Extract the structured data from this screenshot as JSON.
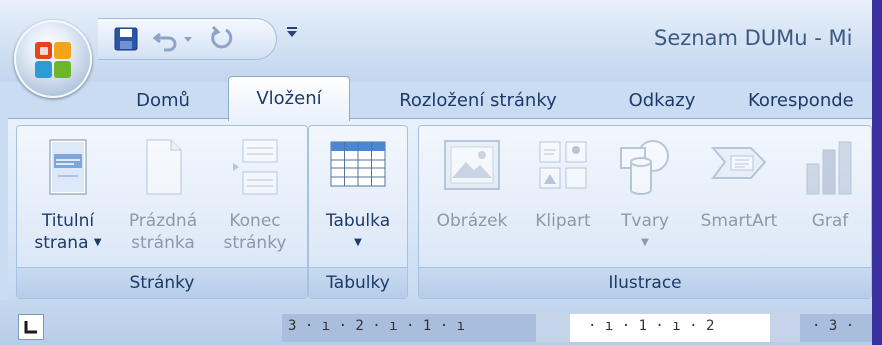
{
  "title": "Seznam DUMu - Mi",
  "tabs": [
    {
      "label": "Domů",
      "active": false
    },
    {
      "label": "Vložení",
      "active": true
    },
    {
      "label": "Rozložení stránky",
      "active": false
    },
    {
      "label": "Odkazy",
      "active": false
    },
    {
      "label": "Koresponde",
      "active": false
    }
  ],
  "groups": {
    "pages": {
      "label": "Stránky",
      "buttons": [
        {
          "line1": "Titulní",
          "line2": "strana",
          "dropdown": true,
          "icon": "cover-page-icon",
          "enabled": true
        },
        {
          "line1": "Prázdná",
          "line2": "stránka",
          "icon": "blank-page-icon",
          "enabled": false
        },
        {
          "line1": "Konec",
          "line2": "stránky",
          "icon": "page-break-icon",
          "enabled": false
        }
      ]
    },
    "tables": {
      "label": "Tabulky",
      "buttons": [
        {
          "line1": "Tabulka",
          "dropdown": true,
          "icon": "table-icon",
          "enabled": true
        }
      ]
    },
    "illustrations": {
      "label": "Ilustrace",
      "buttons": [
        {
          "line1": "Obrázek",
          "icon": "picture-icon",
          "enabled": false
        },
        {
          "line1": "Klipart",
          "icon": "clipart-icon",
          "enabled": false
        },
        {
          "line1": "Tvary",
          "dropdown": true,
          "icon": "shapes-icon",
          "enabled": false
        },
        {
          "line1": "SmartArt",
          "icon": "smartart-icon",
          "enabled": false
        },
        {
          "line1": "Graf",
          "icon": "chart-icon",
          "enabled": false
        }
      ]
    }
  },
  "ruler": {
    "left_text": "3 · ı · 2 · ı · 1 · ı",
    "right_text": "· ı · 1 · ı · 2",
    "far_text": "· 3 ·"
  },
  "colors": {
    "background": "#3a2f9f",
    "ribbon": "#d8e6f7",
    "text": "#1d3a6a",
    "disabled_text": "#8c99ab"
  }
}
